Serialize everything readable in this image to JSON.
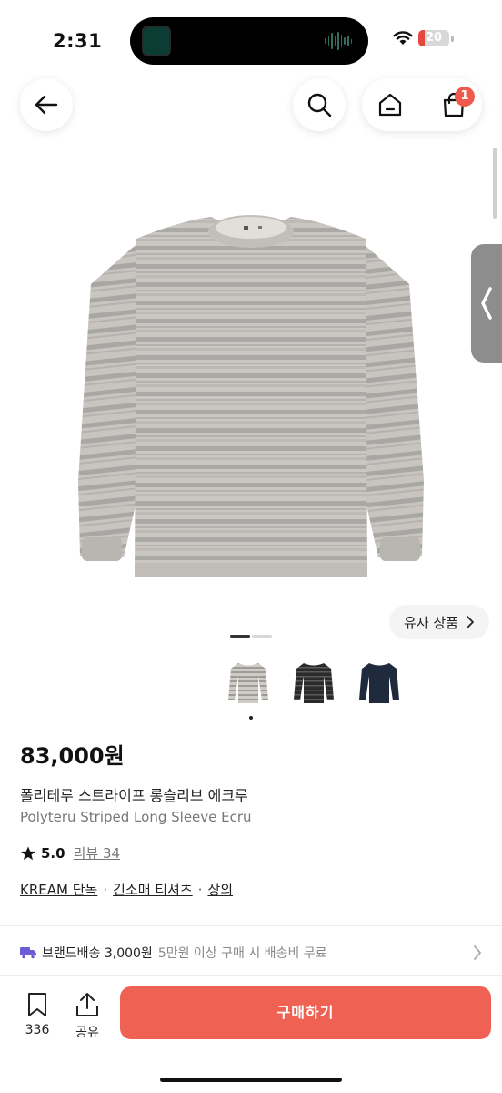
{
  "status_bar": {
    "time": "2:31",
    "battery_level": "20",
    "battery_percent": 20,
    "icons": [
      "wifi-icon",
      "battery-icon"
    ]
  },
  "nav": {
    "icons": [
      "back-arrow-icon",
      "search-icon",
      "home-icon",
      "cart-icon"
    ],
    "cart_badge": "1"
  },
  "product": {
    "similar_button_label": "유사 상품",
    "image_count": 2,
    "current_image": 1,
    "colors": [
      "stripe-ecru",
      "stripe-black",
      "navy"
    ],
    "selected_color_index": 0,
    "price": "83,000원",
    "name_ko": "폴리테루 스트라이프 롱슬리브 에크루",
    "name_en": "Polyteru Striped Long Sleeve Ecru",
    "rating": "5.0",
    "review_label": "리뷰 34",
    "categories": [
      "KREAM 단독",
      "긴소매 티셔츠",
      "상의"
    ]
  },
  "shipping": {
    "main": "브랜드배송 3,000원",
    "sub": "5만원 이상 구매 시 배송비 무료"
  },
  "bottom_bar": {
    "wishlist_count": "336",
    "share_label": "공유",
    "buy_label": "구매하기"
  },
  "colors": {
    "accent": "#EF6152",
    "badge": "#EF5A4C",
    "shipping_icon": "#6B5BD6"
  }
}
